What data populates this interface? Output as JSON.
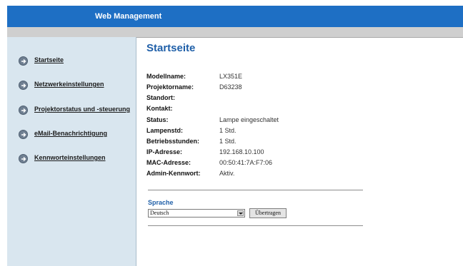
{
  "header": {
    "title": "Web Management",
    "color": "#1e6fc4"
  },
  "sidebar": {
    "items": [
      {
        "label": "Startseite",
        "icon": "arrow-right-circle-icon"
      },
      {
        "label": "Netzwerkeinstellungen",
        "icon": "arrow-right-circle-icon"
      },
      {
        "label": "Projektorstatus und -steuerung",
        "icon": "arrow-right-circle-icon"
      },
      {
        "label": "eMail-Benachrichtigung",
        "icon": "arrow-right-circle-icon"
      },
      {
        "label": "Kennworteinstellungen",
        "icon": "arrow-right-circle-icon"
      }
    ]
  },
  "main": {
    "title": "Startseite",
    "info": [
      {
        "label": "Modellname:",
        "value": "LX351E"
      },
      {
        "label": "Projektorname:",
        "value": "D63238"
      },
      {
        "label": "Standort:",
        "value": ""
      },
      {
        "label": "Kontakt:",
        "value": ""
      },
      {
        "label": "Status:",
        "value": "Lampe eingeschaltet"
      },
      {
        "label": "Lampenstd:",
        "value": "1 Std."
      },
      {
        "label": "Betriebsstunden:",
        "value": "1 Std."
      },
      {
        "label": "IP-Adresse:",
        "value": "192.168.10.100"
      },
      {
        "label": "MAC-Adresse:",
        "value": "00:50:41:7A:F7:06"
      },
      {
        "label": "Admin-Kennwort:",
        "value": "Aktiv."
      }
    ],
    "language": {
      "title": "Sprache",
      "selected": "Deutsch",
      "button": "Übertragen"
    }
  }
}
